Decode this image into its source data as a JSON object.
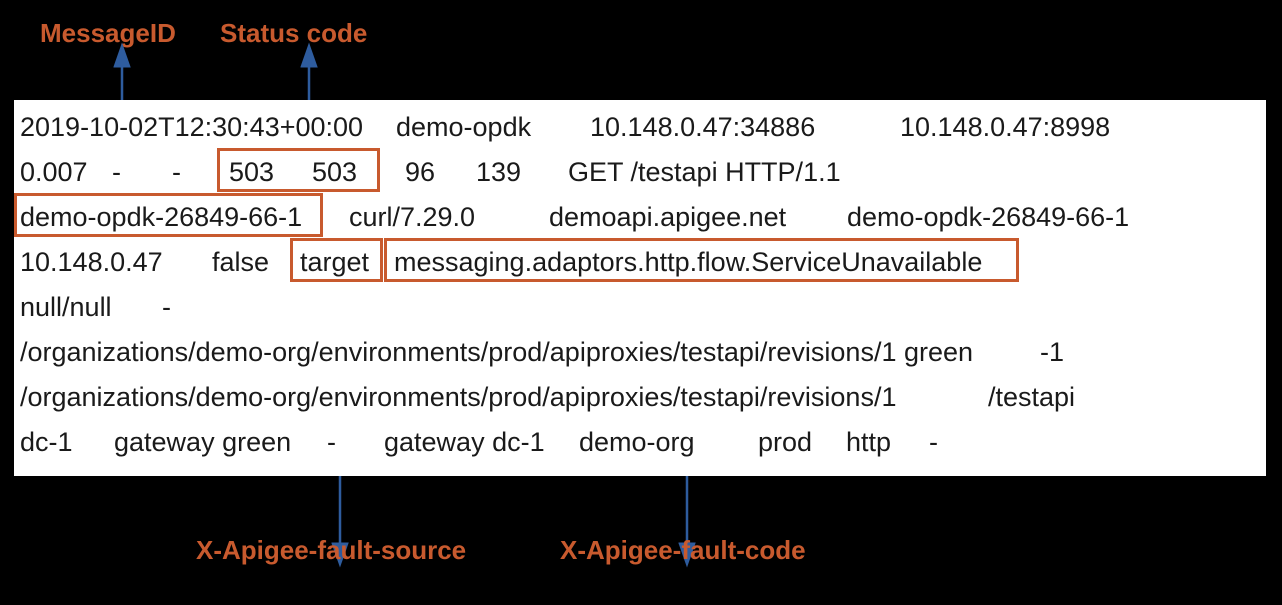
{
  "labels": {
    "topLeft": "MessageID",
    "topRight": "Status code",
    "bottomLeft": "X-Apigee-fault-source",
    "bottomRight": "X-Apigee-fault-code"
  },
  "log": {
    "line1_a": "2019-10-02T12:30:43+00:00",
    "line1_b": "demo-opdk",
    "line1_c": "10.148.0.47:34886",
    "line1_d": "10.148.0.47:8998",
    "line2_a": "0.007",
    "line2_b": "-",
    "line2_c": "-",
    "line2_d": "503",
    "line2_e": "503",
    "line2_f": "96",
    "line2_g": "139",
    "line2_h": "GET /testapi HTTP/1.1",
    "line3_a": "demo-opdk-26849-66-1",
    "line3_b": "curl/7.29.0",
    "line3_c": "demoapi.apigee.net",
    "line3_d": "demo-opdk-26849-66-1",
    "line4_a": "10.148.0.47",
    "line4_b": "false",
    "line4_c": "target",
    "line4_d": "messaging.adaptors.http.flow.ServiceUnavailable",
    "line5_a": "null/null",
    "line5_b": "-",
    "line6_a": "/organizations/demo-org/environments/prod/apiproxies/testapi/revisions/1 green",
    "line6_b": "-1",
    "line7_a": "/organizations/demo-org/environments/prod/apiproxies/testapi/revisions/1",
    "line7_b": "/testapi",
    "line8_a": "dc-1",
    "line8_b": "gateway green",
    "line8_c": "-",
    "line8_d": "gateway dc-1",
    "line8_e": "demo-org",
    "line8_f": "prod",
    "line8_g": "http",
    "line8_h": "-"
  }
}
